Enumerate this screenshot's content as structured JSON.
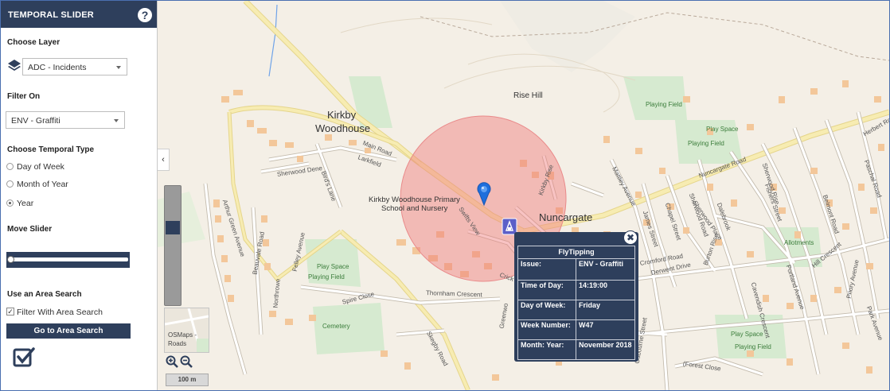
{
  "sidebar": {
    "title": "TEMPORAL SLIDER",
    "help_label": "?",
    "choose_layer_label": "Choose Layer",
    "layer_select_value": "ADC - Incidents",
    "filter_on_label": "Filter On",
    "filter_select_value": "ENV - Graffiti",
    "temporal_type_label": "Choose Temporal Type",
    "temporal_options": [
      "Day of Week",
      "Month of Year",
      "Year"
    ],
    "temporal_selected": "Year",
    "move_slider_label": "Move Slider",
    "slider_position": 0,
    "area_search_label": "Use an Area Search",
    "filter_area_checkbox_label": "Filter With Area Search",
    "filter_area_checked": true,
    "checkbox_mark": "✓",
    "go_area_button_label": "Go to Area Search",
    "collapse_glyph": "‹"
  },
  "map_controls": {
    "basemap_label_line1": "OSMaps -",
    "basemap_label_line2": "Roads",
    "scale_label": "100 m",
    "zoom_level_fraction": 0.33
  },
  "map_labels": {
    "kirkby_line1": "Kirkby",
    "kirkby_line2": "Woodhouse",
    "nuncargate": "Nuncargate",
    "rise_hill": "Rise Hill",
    "school_line1": "Kirkby Woodhouse Primary",
    "school_line2": "School and Nursery",
    "playing_field_1": "Playing Field",
    "play_space_1": "Play Space",
    "playing_field_2": "Playing Field",
    "play_space_2": "Play Space",
    "playing_field_3": "Playing Field",
    "cemetery": "Cemetery",
    "allotments": "Allotments",
    "play_space_3": "Play Space",
    "playing_field_4": "Playing Field",
    "streets": {
      "main_road": "Main Road",
      "sherwood_dene": "Sherwood Dene",
      "larkfield": "Larkfield",
      "birds_lane": "Bird's Lane",
      "arthur_green": "Arthur Green Avenue",
      "beauvale_road": "Beauvale Road",
      "felley_avenue": "Felley Avenue",
      "northrowe": "Northrowe",
      "spire_close": "Spire Close",
      "thornham_crescent": "Thornham Crescent",
      "skegby_road": "Skegby Road",
      "greenwood": "Greenwo",
      "swifts_view": "Swifts View",
      "kirkby_rise": "Kirkby Rise",
      "nuncargate_road": "Nuncargate Road",
      "mattley_avenue": "Mattley Avenue",
      "james_street": "James Street",
      "chapel_street": "Chapel Street",
      "sherwood_road": "Sherwood Road",
      "dalebrook": "Dalebrook",
      "sherwood_place": "Sherwood Place",
      "cromford_road": "Cromford Road",
      "derwent_drive": "Derwent Drive",
      "burton_rise": "Burton Rise",
      "cavendish_crescent": "Cavendish Crescent",
      "fishers_street": "Fishers Street",
      "portland_avenue": "Portland Avenue",
      "priory_avenue": "Priory Avenue",
      "park_avenue": "Park Avenue",
      "hill_crescent": "Hill Crescent",
      "forest_close": "(Forest Close",
      "osbourne_street": "Osbourne Street",
      "herbert_road": "Herbert Road",
      "paschal_road": "Paschal Road",
      "belmont_road": "Belmont Road",
      "sherwood_rise": "Sherwood Rise",
      "crick": "Crick"
    }
  },
  "popup": {
    "title": "FlyTipping",
    "close_label": "✖",
    "rows": [
      {
        "label": "Issue:",
        "value": "ENV - Graffiti"
      },
      {
        "label": "Time of Day:",
        "value": "14:19:00"
      },
      {
        "label": "Day of Week:",
        "value": "Friday"
      },
      {
        "label": "Week Number:",
        "value": "W47"
      },
      {
        "label": "Month: Year:",
        "value": "November 2018"
      }
    ]
  },
  "icons": {
    "layers": "layers-icon",
    "help": "help-icon",
    "zoom_in": "zoom-in-icon",
    "zoom_out": "zoom-out-icon",
    "marker": "map-pin-icon",
    "flytip": "flytipping-icon",
    "check": "checklist-icon"
  },
  "colors": {
    "panel_dark": "#2e3f5c",
    "buffer": "#f07a7a",
    "road_major": "#f7ecb2",
    "building": "#f3c79a",
    "green": "#d6ead0",
    "pin": "#1f6fdc"
  }
}
